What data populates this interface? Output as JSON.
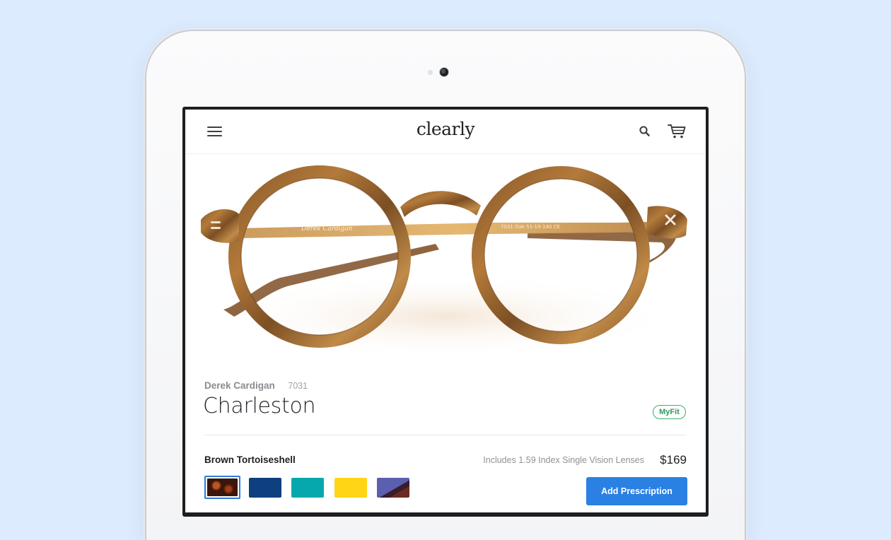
{
  "header": {
    "logo": "clearly",
    "menu_icon": "hamburger-menu-icon",
    "search_icon": "search-icon",
    "cart_icon": "shopping-cart-icon"
  },
  "product": {
    "brand": "Derek Cardigan",
    "model_number": "7031",
    "name": "Charleston",
    "myfit_badge": "MyFit",
    "selected_color": "Brown Tortoiseshell",
    "lens_info": "Includes 1.59 Index Single Vision Lenses",
    "price": "$169",
    "frame_temple_text": "7031   Oak   51-19-140   CE",
    "add_prescription_label": "Add Prescription"
  },
  "swatches": [
    {
      "name": "brown-tortoiseshell",
      "color": "#5a2412",
      "selected": true
    },
    {
      "name": "navy",
      "color": "#0e3f7e",
      "selected": false
    },
    {
      "name": "teal",
      "color": "#07a8ad",
      "selected": false
    },
    {
      "name": "yellow",
      "color": "#ffd515",
      "selected": false
    },
    {
      "name": "purple-tortoise",
      "color": "#5a5fb0",
      "selected": false
    }
  ],
  "colors": {
    "page_background": "#dcebfd",
    "accent_blue": "#2b80e4",
    "myfit_green": "#3dae6f"
  }
}
